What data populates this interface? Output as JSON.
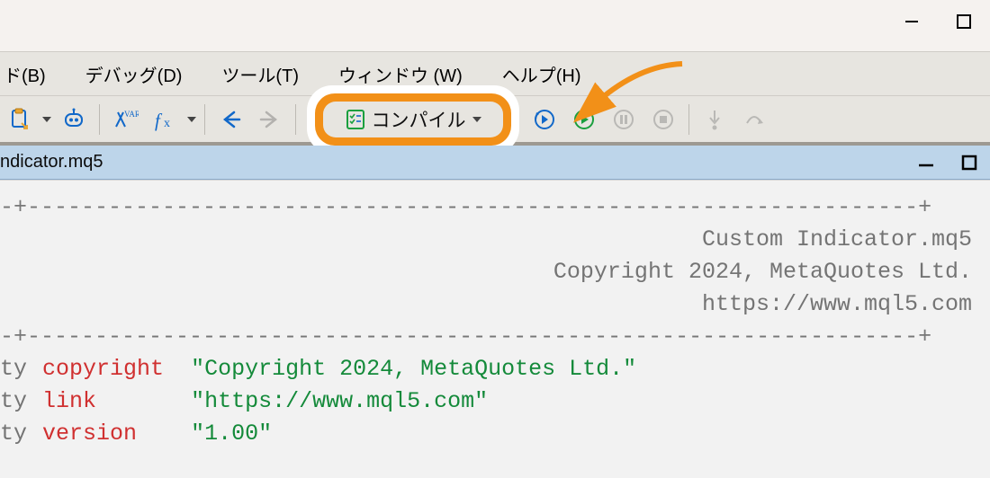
{
  "menu": {
    "build": "ド(B)",
    "debug": "デバッグ(D)",
    "tools": "ツール(T)",
    "window": "ウィンドウ (W)",
    "help": "ヘルプ(H)"
  },
  "toolbar": {
    "compile_label": "コンパイル"
  },
  "tab": {
    "filename": "ndicator.mq5"
  },
  "editor": {
    "dashes": "-+------------------------------------------------------------------+",
    "comment1": "Custom Indicator.mq5",
    "comment2": "Copyright 2024, MetaQuotes Ltd.",
    "comment3": "https://www.mql5.com",
    "dashes2": "-+------------------------------------------------------------------+",
    "lines": [
      {
        "ty": "ty ",
        "kw": "copyright",
        "str": "\"Copyright 2024, MetaQuotes Ltd.\""
      },
      {
        "ty": "ty ",
        "kw": "link",
        "str": "\"https://www.mql5.com\""
      },
      {
        "ty": "ty ",
        "kw": "version",
        "str": "\"1.00\""
      }
    ]
  }
}
